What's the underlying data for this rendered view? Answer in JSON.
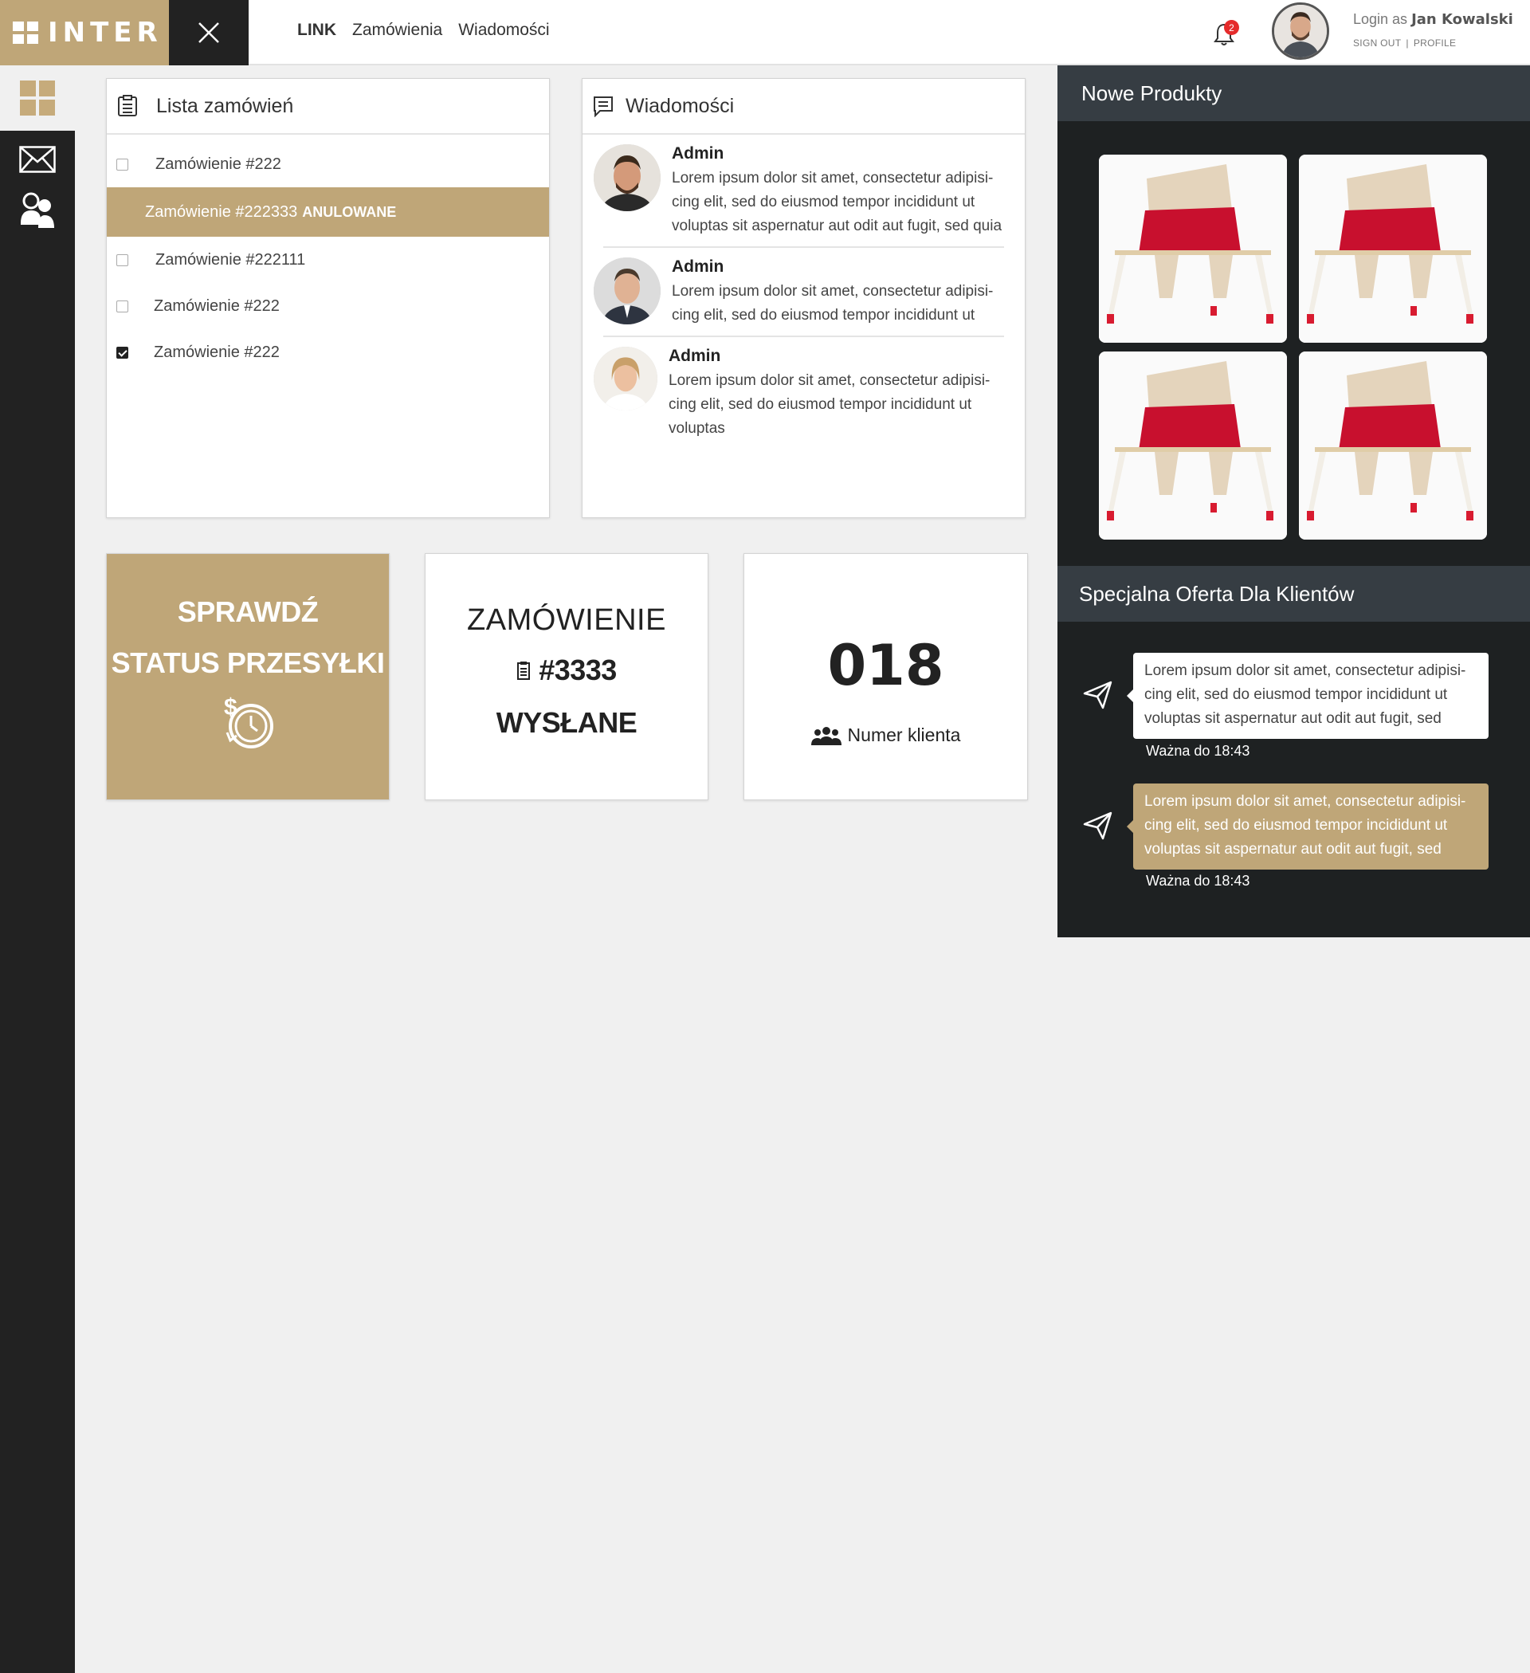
{
  "brand": {
    "logo_text": "INTER",
    "accent": "#bfa678",
    "dark": "#222222"
  },
  "topnav": {
    "items": [
      "LINK",
      "Zamówienia",
      "Wiadomości"
    ]
  },
  "notifications": {
    "count": "2"
  },
  "user": {
    "login_prefix": "Login as",
    "name": "Jan Kowalski",
    "sign_out": "SIGN OUT",
    "separator": "|",
    "profile": "PROFILE"
  },
  "sidebar": {
    "items": [
      "dashboard-icon",
      "mail-icon",
      "users-icon"
    ]
  },
  "orders": {
    "title": "Lista zamówień",
    "rows": [
      {
        "label": "Zamówienie #222",
        "checked": false
      },
      {
        "label": "Zamówienie #222333",
        "status": "ANULOWANE"
      },
      {
        "label": "Zamówienie #222111",
        "checked": false
      },
      {
        "label": "Zamówienie #222",
        "checked": false
      },
      {
        "label": "Zamówienie #222",
        "checked": true
      }
    ]
  },
  "messages": {
    "title": "Wiadomości",
    "items": [
      {
        "author": "Admin",
        "text": "Lorem ipsum dolor sit amet, consectetur adipisi-cing elit, sed do eiusmod tempor incididunt ut voluptas sit aspernatur aut odit aut fugit, sed quia"
      },
      {
        "author": "Admin",
        "text": "Lorem ipsum dolor sit amet, consectetur adipisi-cing elit, sed do eiusmod tempor incididunt ut"
      },
      {
        "author": "Admin",
        "text": "Lorem ipsum dolor sit amet, consectetur adipisi-cing elit, sed do eiusmod tempor incididunt ut voluptas"
      }
    ]
  },
  "tiles": {
    "status": {
      "line1": "SPRAWDŹ",
      "line2": "STATUS PRZESYŁKI"
    },
    "order": {
      "line1": "ZAMÓWIENIE",
      "number": "#3333",
      "state": "WYSŁANE"
    },
    "client": {
      "number": "018",
      "label": "Numer klienta"
    }
  },
  "products": {
    "title": "Nowe Produkty",
    "count": 4
  },
  "offers": {
    "title": "Specjalna Oferta Dla Klientów",
    "items": [
      {
        "text": "Lorem ipsum dolor sit amet, consectetur adipisi-cing elit, sed do eiusmod tempor incididunt ut voluptas sit aspernatur aut odit aut fugit, sed",
        "valid": "Ważna do 18:43",
        "style": "white"
      },
      {
        "text": "Lorem ipsum dolor sit amet, consectetur adipisi-cing elit, sed do eiusmod tempor incididunt ut voluptas sit aspernatur aut odit aut fugit, sed",
        "valid": "Ważna do 18:43",
        "style": "gold"
      }
    ]
  }
}
